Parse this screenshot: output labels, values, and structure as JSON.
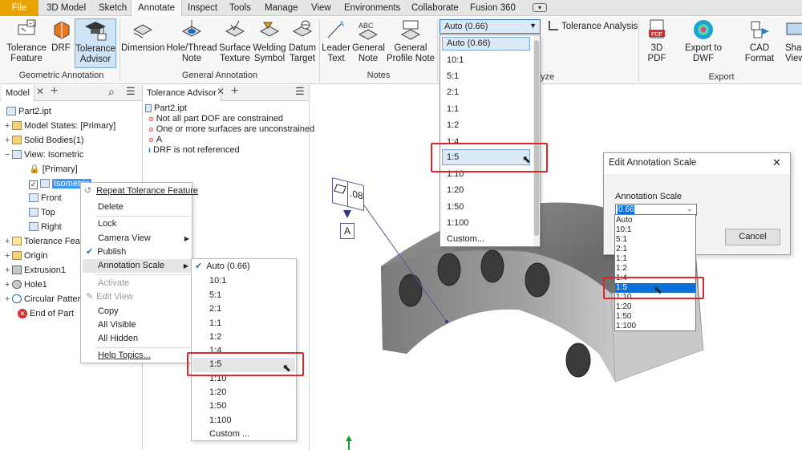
{
  "menubar": {
    "tabs": [
      "File",
      "3D Model",
      "Sketch",
      "Annotate",
      "Inspect",
      "Tools",
      "Manage",
      "View",
      "Environments",
      "Collaborate",
      "Fusion 360"
    ],
    "active_tab": "Annotate"
  },
  "ribbon": {
    "buttons": {
      "tolerance_feature": [
        "Tolerance",
        "Feature"
      ],
      "drf": "DRF",
      "tolerance_advisor": [
        "Tolerance",
        "Advisor"
      ],
      "dimension": "Dimension",
      "hole_thread": [
        "Hole/Thread",
        "Note"
      ],
      "surface_texture": [
        "Surface",
        "Texture"
      ],
      "welding_symbol": [
        "Welding",
        "Symbol"
      ],
      "datum_target": [
        "Datum",
        "Target"
      ],
      "leader_text": [
        "Leader",
        "Text"
      ],
      "general_note": [
        "General",
        "Note"
      ],
      "general_profile_note": [
        "General",
        "Profile Note"
      ],
      "tolerance_analysis": "Tolerance Analysis",
      "pdf_3d": "3D PDF",
      "export_dwf": "Export to DWF",
      "cad_format": "CAD Format",
      "share_view": [
        "Shar",
        "View"
      ]
    },
    "groups": {
      "geometric_annotation": "Geometric Annotation",
      "general_annotation": "General Annotation",
      "notes": "Notes",
      "analyze": "Analyze",
      "export": "Export"
    },
    "scale_combo_value": "Auto (0.66)"
  },
  "model_panel": {
    "tab_label": "Model",
    "items": {
      "root": "Part2.ipt",
      "model_states": "Model States: [Primary]",
      "solid_bodies": "Solid Bodies(1)",
      "view_iso": "View: Isometric",
      "primary": "[Primary]",
      "isometric": "Isometric",
      "front": "Front",
      "top": "Top",
      "right": "Right",
      "tolerance_feat": "Tolerance Feat",
      "origin": "Origin",
      "extrusion1": "Extrusion1",
      "hole1": "Hole1",
      "circular_pattern": "Circular Patter",
      "end_of_part": "End of Part"
    }
  },
  "advisor_panel": {
    "tab_label": "Tolerance Advisor",
    "root": "Part2.ipt",
    "messages": [
      "Not all part DOF are constrained",
      "One or more surfaces are unconstrained",
      "A",
      "DRF is not referenced"
    ]
  },
  "context_menu": {
    "items": [
      "Repeat Tolerance Feature",
      "Delete",
      "Lock",
      "Camera View",
      "Publish",
      "Annotation Scale",
      "Activate",
      "Edit View",
      "Copy",
      "All Visible",
      "All Hidden",
      "Help Topics..."
    ]
  },
  "submenu": {
    "items": [
      "Auto (0.66)",
      "10:1",
      "5:1",
      "2:1",
      "1:1",
      "1:2",
      "1:4",
      "1:5",
      "1:10",
      "1:20",
      "1:50",
      "1:100",
      "Custom ..."
    ]
  },
  "scale_dropdown": {
    "items": [
      "Auto (0.66)",
      "10:1",
      "5:1",
      "2:1",
      "1:1",
      "1:2",
      "1:4",
      "1:5",
      "1:10",
      "1:20",
      "1:50",
      "1:100",
      "Custom..."
    ]
  },
  "dialog": {
    "title": "Edit Annotation Scale",
    "label": "Annotation Scale",
    "value": "0.66",
    "items": [
      "Auto",
      "10:1",
      "5:1",
      "2:1",
      "1:1",
      "1:2",
      "1:4",
      "1:5",
      "1:10",
      "1:20",
      "1:50",
      "1:100"
    ],
    "cancel_label": "Cancel"
  },
  "annotation": {
    "tolerance_value": ".08",
    "datum": "A"
  },
  "colors": {
    "accent": "#e8a300",
    "highlight": "#0a6fd8",
    "selection": "#3399ff",
    "red_callout": "#e0252b"
  }
}
